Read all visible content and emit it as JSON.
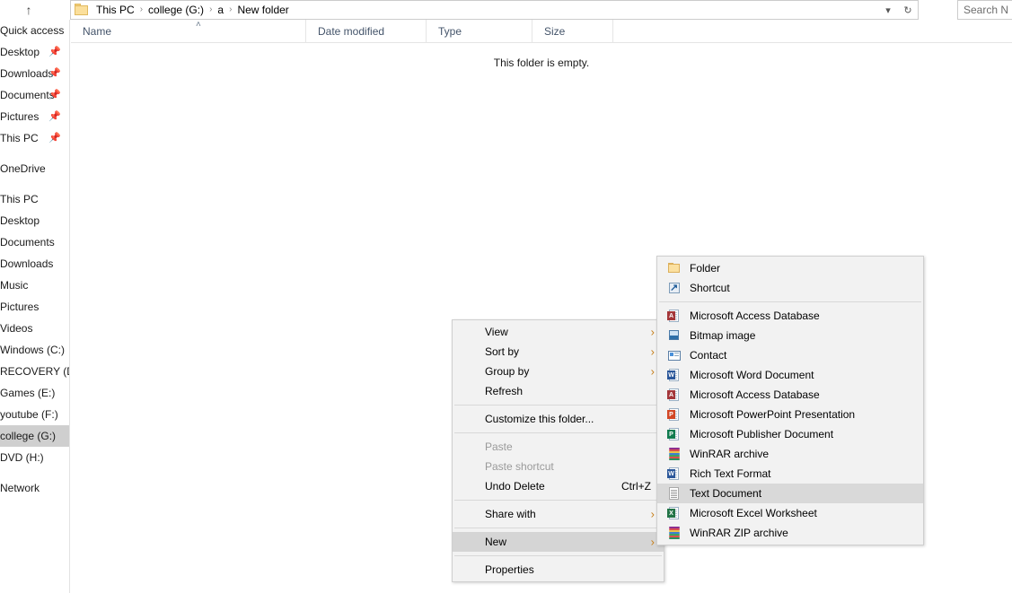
{
  "window": {
    "addressbar": {
      "up_arrow_icon": "up-arrow-icon",
      "folder_icon": "folder-icon",
      "breadcrumbs": [
        "This PC",
        "college (G:)",
        "a",
        "New folder"
      ],
      "separator": "›",
      "dropdown_icon": "chevron-down-icon",
      "refresh_icon": "refresh-icon",
      "search_placeholder": "Search N"
    }
  },
  "sidebar": {
    "items": [
      {
        "label": "Quick access",
        "pinned": false,
        "selected": false,
        "gap_before": false
      },
      {
        "label": "Desktop",
        "pinned": true,
        "selected": false,
        "gap_before": false
      },
      {
        "label": "Downloads",
        "pinned": true,
        "selected": false,
        "gap_before": false
      },
      {
        "label": "Documents",
        "pinned": true,
        "selected": false,
        "gap_before": false
      },
      {
        "label": "Pictures",
        "pinned": true,
        "selected": false,
        "gap_before": false
      },
      {
        "label": "This PC",
        "pinned": true,
        "selected": false,
        "gap_before": false
      },
      {
        "label": "OneDrive",
        "pinned": false,
        "selected": false,
        "gap_before": true
      },
      {
        "label": "This PC",
        "pinned": false,
        "selected": false,
        "gap_before": true
      },
      {
        "label": "Desktop",
        "pinned": false,
        "selected": false,
        "gap_before": false
      },
      {
        "label": "Documents",
        "pinned": false,
        "selected": false,
        "gap_before": false
      },
      {
        "label": "Downloads",
        "pinned": false,
        "selected": false,
        "gap_before": false
      },
      {
        "label": "Music",
        "pinned": false,
        "selected": false,
        "gap_before": false
      },
      {
        "label": "Pictures",
        "pinned": false,
        "selected": false,
        "gap_before": false
      },
      {
        "label": "Videos",
        "pinned": false,
        "selected": false,
        "gap_before": false
      },
      {
        "label": "Windows (C:)",
        "pinned": false,
        "selected": false,
        "gap_before": false
      },
      {
        "label": "RECOVERY (D:)",
        "pinned": false,
        "selected": false,
        "gap_before": false
      },
      {
        "label": "Games (E:)",
        "pinned": false,
        "selected": false,
        "gap_before": false
      },
      {
        "label": "youtube (F:)",
        "pinned": false,
        "selected": false,
        "gap_before": false
      },
      {
        "label": "college (G:)",
        "pinned": false,
        "selected": true,
        "gap_before": false
      },
      {
        "label": "DVD (H:)",
        "pinned": false,
        "selected": false,
        "gap_before": false
      },
      {
        "label": "Network",
        "pinned": false,
        "selected": false,
        "gap_before": true
      }
    ]
  },
  "filelist": {
    "columns": [
      {
        "label": "Name",
        "sorted": true,
        "sort_icon": "sort-ascending-icon"
      },
      {
        "label": "Date modified",
        "sorted": false
      },
      {
        "label": "Type",
        "sorted": false
      },
      {
        "label": "Size",
        "sorted": false
      }
    ],
    "empty_message": "This folder is empty."
  },
  "context_menu": {
    "items": [
      {
        "label": "View",
        "type": "item",
        "submenu": true,
        "disabled": false,
        "highlight": false,
        "shortcut": ""
      },
      {
        "label": "Sort by",
        "type": "item",
        "submenu": true,
        "disabled": false,
        "highlight": false,
        "shortcut": ""
      },
      {
        "label": "Group by",
        "type": "item",
        "submenu": true,
        "disabled": false,
        "highlight": false,
        "shortcut": ""
      },
      {
        "label": "Refresh",
        "type": "item",
        "submenu": false,
        "disabled": false,
        "highlight": false,
        "shortcut": ""
      },
      {
        "label": "",
        "type": "separator"
      },
      {
        "label": "Customize this folder...",
        "type": "item",
        "submenu": false,
        "disabled": false,
        "highlight": false,
        "shortcut": ""
      },
      {
        "label": "",
        "type": "separator"
      },
      {
        "label": "Paste",
        "type": "item",
        "submenu": false,
        "disabled": true,
        "highlight": false,
        "shortcut": ""
      },
      {
        "label": "Paste shortcut",
        "type": "item",
        "submenu": false,
        "disabled": true,
        "highlight": false,
        "shortcut": ""
      },
      {
        "label": "Undo Delete",
        "type": "item",
        "submenu": false,
        "disabled": false,
        "highlight": false,
        "shortcut": "Ctrl+Z"
      },
      {
        "label": "",
        "type": "separator"
      },
      {
        "label": "Share with",
        "type": "item",
        "submenu": true,
        "disabled": false,
        "highlight": false,
        "shortcut": ""
      },
      {
        "label": "",
        "type": "separator"
      },
      {
        "label": "New",
        "type": "item",
        "submenu": true,
        "disabled": false,
        "highlight": true,
        "shortcut": ""
      },
      {
        "label": "",
        "type": "separator"
      },
      {
        "label": "Properties",
        "type": "item",
        "submenu": false,
        "disabled": false,
        "highlight": false,
        "shortcut": ""
      }
    ]
  },
  "new_submenu": {
    "items": [
      {
        "label": "Folder",
        "icon": "folder-icon",
        "highlight": false,
        "separator_after": false
      },
      {
        "label": "Shortcut",
        "icon": "shortcut-icon",
        "highlight": false,
        "separator_after": true
      },
      {
        "label": "Microsoft Access Database",
        "icon": "access-database-icon",
        "highlight": false,
        "separator_after": false
      },
      {
        "label": "Bitmap image",
        "icon": "bitmap-image-icon",
        "highlight": false,
        "separator_after": false
      },
      {
        "label": "Contact",
        "icon": "contact-icon",
        "highlight": false,
        "separator_after": false
      },
      {
        "label": "Microsoft Word Document",
        "icon": "word-document-icon",
        "highlight": false,
        "separator_after": false
      },
      {
        "label": "Microsoft Access Database",
        "icon": "access-database-icon",
        "highlight": false,
        "separator_after": false
      },
      {
        "label": "Microsoft PowerPoint Presentation",
        "icon": "powerpoint-icon",
        "highlight": false,
        "separator_after": false
      },
      {
        "label": "Microsoft Publisher Document",
        "icon": "publisher-icon",
        "highlight": false,
        "separator_after": false
      },
      {
        "label": "WinRAR archive",
        "icon": "winrar-archive-icon",
        "highlight": false,
        "separator_after": false
      },
      {
        "label": "Rich Text Format",
        "icon": "rich-text-icon",
        "highlight": false,
        "separator_after": false
      },
      {
        "label": "Text Document",
        "icon": "text-document-icon",
        "highlight": true,
        "separator_after": false
      },
      {
        "label": "Microsoft Excel Worksheet",
        "icon": "excel-worksheet-icon",
        "highlight": false,
        "separator_after": false
      },
      {
        "label": "WinRAR ZIP archive",
        "icon": "winrar-zip-icon",
        "highlight": false,
        "separator_after": false
      }
    ]
  },
  "colors": {
    "menu_bg": "#f2f2f2",
    "menu_border": "#cfcfcf",
    "highlight": "#d5d5d5",
    "submenu_arrow": "#c7801c",
    "column_header_text": "#44546a",
    "selected_nav": "#cfcfcf"
  }
}
